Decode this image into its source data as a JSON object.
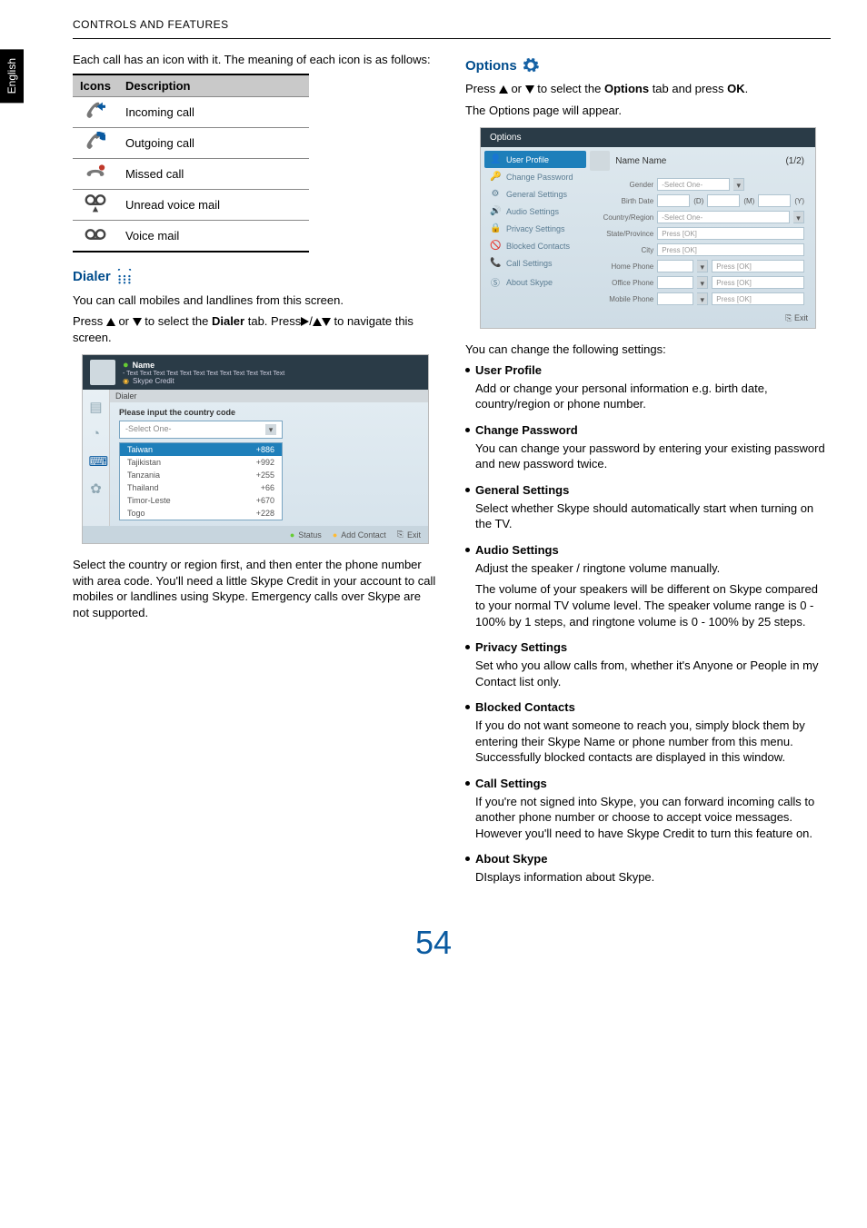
{
  "header": {
    "section_title": "CONTROLS AND FEATURES",
    "language_tab": "English"
  },
  "left": {
    "intro": "Each call has an icon with it. The meaning of each icon is as follows:",
    "table": {
      "h_icons": "Icons",
      "h_desc": "Description",
      "rows": [
        "Incoming call",
        "Outgoing call",
        "Missed call",
        "Unread voice mail",
        "Voice mail"
      ]
    },
    "dialer": {
      "title": "Dialer",
      "line1": "You can call mobiles and landlines from this screen.",
      "line2_pre": "Press ",
      "line2_mid1": " or ",
      "line2_mid2": " to select  the ",
      "line2_tab": "Dialer",
      "line2_mid3": " tab. Press",
      "line2_mid4": "/",
      "line2_post": " to navigate this screen.",
      "shot": {
        "name": "Name",
        "sub": "- Text Text Text Text Text Text Text Text Text Text Text Text",
        "credit": "Skype Credit",
        "panel_title": "Dialer",
        "prompt": "Please input the country code",
        "select_placeholder": "-Select One-",
        "countries": [
          {
            "n": "Taiwan",
            "c": "+886"
          },
          {
            "n": "Tajikistan",
            "c": "+992"
          },
          {
            "n": "Tanzania",
            "c": "+255"
          },
          {
            "n": "Thailand",
            "c": "+66"
          },
          {
            "n": "Timor-Leste",
            "c": "+670"
          },
          {
            "n": "Togo",
            "c": "+228"
          }
        ],
        "footer": {
          "status": "Status",
          "add": "Add Contact",
          "exit": "Exit"
        }
      },
      "para2": "Select the country or region first, and then enter the phone number with area code. You'll need a little Skype Credit in your account to call mobiles or landlines using Skype. Emergency calls over Skype are not supported."
    }
  },
  "right": {
    "options": {
      "title": "Options",
      "line1_pre": "Press ",
      "line1_mid1": " or ",
      "line1_mid2": " to select  the ",
      "line1_tab": "Options",
      "line1_mid3": " tab and press ",
      "line1_ok": "OK",
      "line1_post": ".",
      "line2": "The Options page will appear.",
      "shot": {
        "title": "Options",
        "items": [
          "User Profile",
          "Change Password",
          "General Settings",
          "Audio Settings",
          "Privacy Settings",
          "Blocked Contacts",
          "Call Settings",
          "About Skype"
        ],
        "name_name": "Name Name",
        "pager": "(1/2)",
        "fields": {
          "gender": "Gender",
          "birth": "Birth Date",
          "country": "Country/Region",
          "state": "State/Province",
          "city": "City",
          "home": "Home Phone",
          "office": "Office Phone",
          "mobile": "Mobile Phone"
        },
        "select_one": "-Select One-",
        "press_ok": "Press [OK]",
        "d": "(D)",
        "m": "(M)",
        "y": "(Y)",
        "exit": "Exit"
      },
      "after": "You can change the following settings:",
      "bullets": [
        {
          "t": "User Profile",
          "b": "Add or change your personal information e.g. birth date, country/region or phone number."
        },
        {
          "t": "Change Password",
          "b": "You can change your password by entering your existing password and new password twice."
        },
        {
          "t": "General Settings",
          "b": "Select whether Skype should automatically start when turning on the TV."
        },
        {
          "t": "Audio Settings",
          "b": "Adjust the speaker / ringtone volume manually.",
          "b2": "The volume of your speakers will be different on Skype compared to your normal TV volume level. The speaker volume range is 0 - 100% by 1 steps, and ringtone volume is 0 - 100% by 25 steps."
        },
        {
          "t": "Privacy Settings",
          "b": "Set who you allow calls from, whether it's Anyone or People in my Contact list only."
        },
        {
          "t": "Blocked Contacts",
          "b": "If you do not want someone to reach you, simply block them by entering their Skype Name or phone number from this menu. Successfully blocked contacts are displayed in this window."
        },
        {
          "t": "Call Settings",
          "b": "If you're not signed into Skype, you can forward incoming calls to another phone number or choose to accept voice messages. However you'll need to have Skype Credit to turn this feature on."
        },
        {
          "t": "About Skype",
          "b": "DIsplays information about Skype."
        }
      ]
    }
  },
  "page_number": "54"
}
